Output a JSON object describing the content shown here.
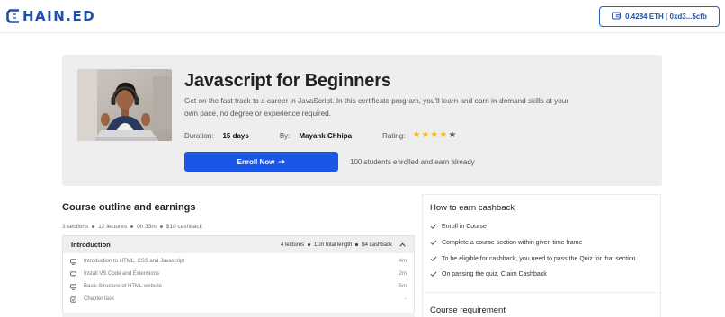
{
  "brand": {
    "logo_letter": "C",
    "logo_text": "HAIN.ED",
    "color": "#1f4fa8"
  },
  "wallet": {
    "label": "0.4284 ETH | 0xd3...5cfb"
  },
  "course": {
    "title": "Javascript for Beginners",
    "description": "Get on the fast track to a career in JavaScript. In this certificate program, you'll learn and earn in-demand skills at your own pace, no degree or experience required.",
    "duration_label": "Duration:",
    "duration_value": "15 days",
    "by_label": "By:",
    "author": "Mayank Chhipa",
    "rating_label": "Rating:",
    "rating": 4,
    "rating_max": 5,
    "enroll_label": "Enroll Now",
    "enrolled_note": "100 students enrolled and earn already"
  },
  "outline": {
    "title": "Course outline and earnings",
    "summary": [
      "3 sections",
      "12 lectures",
      "0h 33m",
      "$10 cashback"
    ],
    "section": {
      "name": "Introduction",
      "lectures": "4 lectures",
      "length": "11m total length",
      "cashback": "$4 cashback",
      "items": [
        {
          "title": "Introduction to HTML, CSS and Javascript",
          "duration": "4m",
          "icon": "monitor-icon"
        },
        {
          "title": "Install VS Code and Extensions",
          "duration": "2m",
          "icon": "monitor-icon"
        },
        {
          "title": "Basic Structure of HTML website",
          "duration": "5m",
          "icon": "monitor-icon"
        },
        {
          "title": "Chapter task",
          "duration": "-",
          "icon": "task-icon"
        }
      ]
    }
  },
  "cashback": {
    "title": "How to earn cashback",
    "steps": [
      "Enroll in Course",
      "Complete a course section within given time frame",
      "To be eligible for cashback, you need to pass the Quiz for that section",
      "On passing the quiz, Claim Cashback"
    ]
  },
  "requirements": {
    "title": "Course requirement"
  },
  "colors": {
    "accent": "#1b57e6",
    "star": "#f5b70a",
    "star_empty": "#555555"
  }
}
